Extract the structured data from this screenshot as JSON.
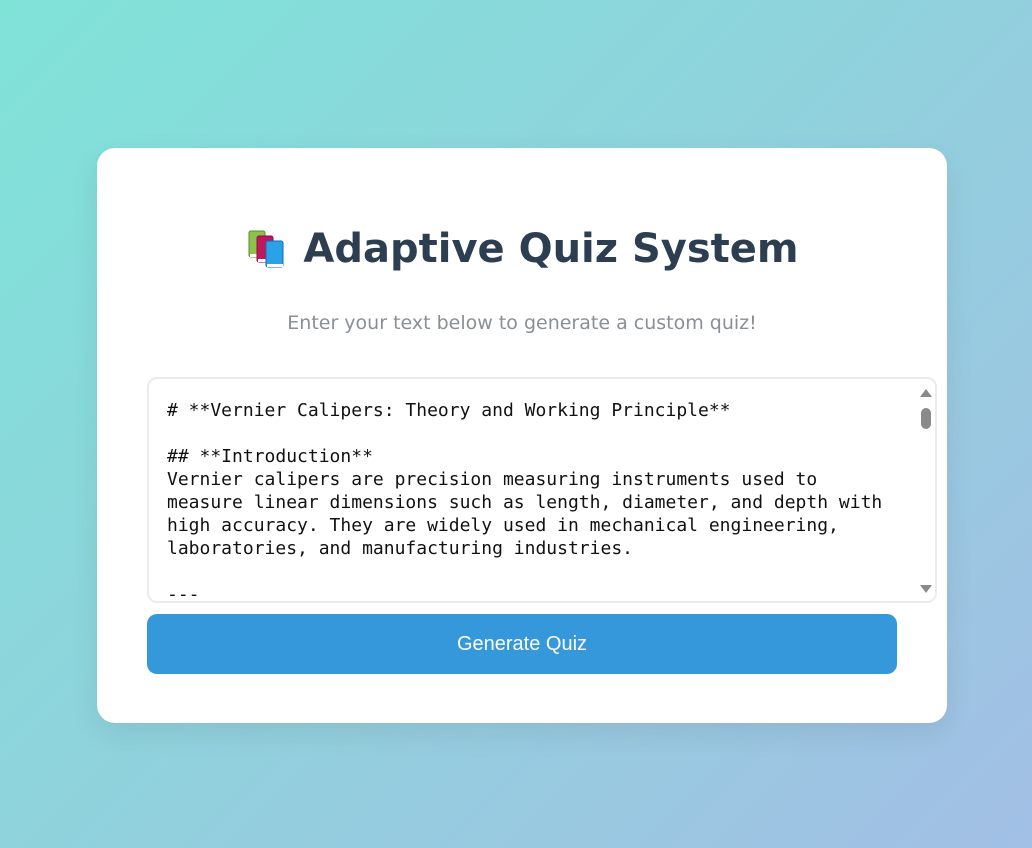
{
  "app": {
    "title": "Adaptive Quiz System",
    "subtitle": "Enter your text below to generate a custom quiz!",
    "title_icon": "books-icon"
  },
  "input": {
    "value": "# **Vernier Calipers: Theory and Working Principle**\n\n## **Introduction**\nVernier calipers are precision measuring instruments used to measure linear dimensions such as length, diameter, and depth with high accuracy. They are widely used in mechanical engineering, laboratories, and manufacturing industries.\n\n---"
  },
  "actions": {
    "generate_label": "Generate Quiz"
  },
  "colors": {
    "accent": "#3498db",
    "title": "#2c3e50",
    "subtitle": "#8a8f95"
  }
}
